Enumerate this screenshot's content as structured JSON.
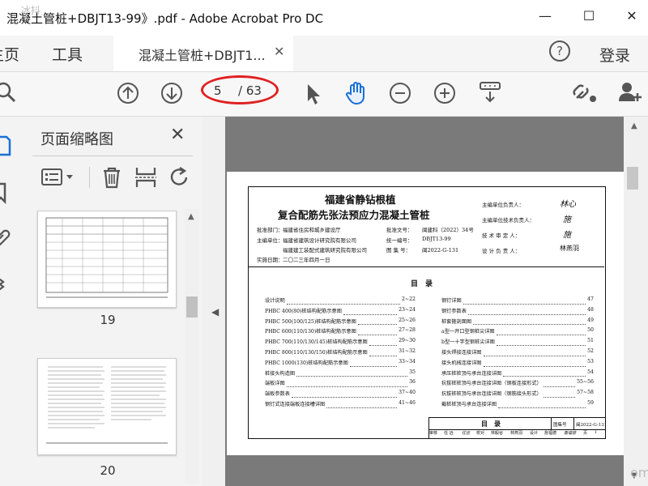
{
  "window": {
    "title": "混凝土管桩+DBJT13-99》.pdf - Adobe Acrobat Pro DC",
    "watermark": "冰抖",
    "minimize": "—",
    "maximize": "☐",
    "close": "✕"
  },
  "menu": {
    "home": "主页",
    "tools": "工具",
    "doc_tab": "混凝土管桩+DBJT1...",
    "tab_close": "✕",
    "help": "?",
    "login": "登录"
  },
  "toolbar": {
    "page_current": "5",
    "page_total": "/ 63"
  },
  "thumbnails": {
    "title": "页面缩略图",
    "close": "✕",
    "pages": [
      {
        "number": "19"
      },
      {
        "number": "20"
      }
    ]
  },
  "document": {
    "title_line1": "福建省静钻根植",
    "title_line2": "复合配筋先张法预应力混凝土管桩",
    "info": {
      "approval_dept_label": "批准部门：",
      "approval_dept": "福建省住房和城乡建设厅",
      "editor_label": "主编单位：",
      "editor": "福建省建筑设计研究院有限公司",
      "editor2": "福建建工装配式建筑研究院有限公司",
      "date_label": "实施日期：",
      "date": "二〇二三年四月一日",
      "doc_no_label": "批准文号：",
      "doc_no": "闽建科（2022）34号",
      "unified_no_label": "统一编号：",
      "unified_no": "DBJT13-99",
      "atlas_no_label": "图 集 号：",
      "atlas_no": "闽2022-G-131"
    },
    "people": [
      {
        "label": "主编单位负责人：",
        "sign": "林心"
      },
      {
        "label": "主编单位技术负责人：",
        "sign": "施"
      },
      {
        "label": "技 术 审 定 人：",
        "sign": "施"
      },
      {
        "label": "设 计 负 责 人：",
        "sign": "林燕羽"
      }
    ],
    "toc_title": "目　录",
    "toc_left": [
      {
        "item": "设计说明",
        "page": "2~22"
      },
      {
        "item": "PHBC 400(80)桩结构配筋示意图",
        "page": "23~24"
      },
      {
        "item": "PHBC 500(100/125)桩结构配筋示意图",
        "page": "25~26"
      },
      {
        "item": "PHBC 600(110/130)桩结构配筋示意图",
        "page": "27~28"
      },
      {
        "item": "PHBC 700(110/130/145)桩结构配筋示意图",
        "page": "29~30"
      },
      {
        "item": "PHBC 800(110/130/150)桩结构配筋示意图",
        "page": "31~32"
      },
      {
        "item": "PHBC 1000(130)桩结构配筋示意图",
        "page": "33~34"
      },
      {
        "item": "桩接头构造图",
        "page": "35"
      },
      {
        "item": "端板详图",
        "page": "36"
      },
      {
        "item": "端板参数表",
        "page": "37~40"
      },
      {
        "item": "钢钉式连接端板连接槽详图",
        "page": "41~46"
      }
    ],
    "toc_right": [
      {
        "item": "钢钉详图",
        "page": "47"
      },
      {
        "item": "钢钉参数表",
        "page": "48"
      },
      {
        "item": "桩套箍剖面图",
        "page": "49"
      },
      {
        "item": "a型一开口型钢桩尖详图",
        "page": "50"
      },
      {
        "item": "b型一十字型钢桩尖详图",
        "page": "51"
      },
      {
        "item": "接头焊接连接详图",
        "page": "52"
      },
      {
        "item": "接头机械连接详图",
        "page": "53"
      },
      {
        "item": "承压桩桩顶与承台连接详图",
        "page": "54"
      },
      {
        "item": "抗拔桩桩顶与承台连接详图（钢板连接形式）",
        "page": "55~56"
      },
      {
        "item": "抗拔桩桩顶与承台连接详图（钢筋接头形式）",
        "page": "57~58"
      },
      {
        "item": "截桩桩顶与承台连接详图",
        "page": "59"
      }
    ],
    "titleblock": {
      "name": "目　录",
      "atlas_label": "图集号",
      "atlas": "闽2022-G-131",
      "row": [
        "审核",
        "任 远",
        "任远",
        "校对",
        "林毅谷",
        "林燕羽",
        "设计",
        "詹福德",
        "詹福德",
        "页"
      ],
      "page": "1"
    },
    "footer_watermark": "om"
  }
}
